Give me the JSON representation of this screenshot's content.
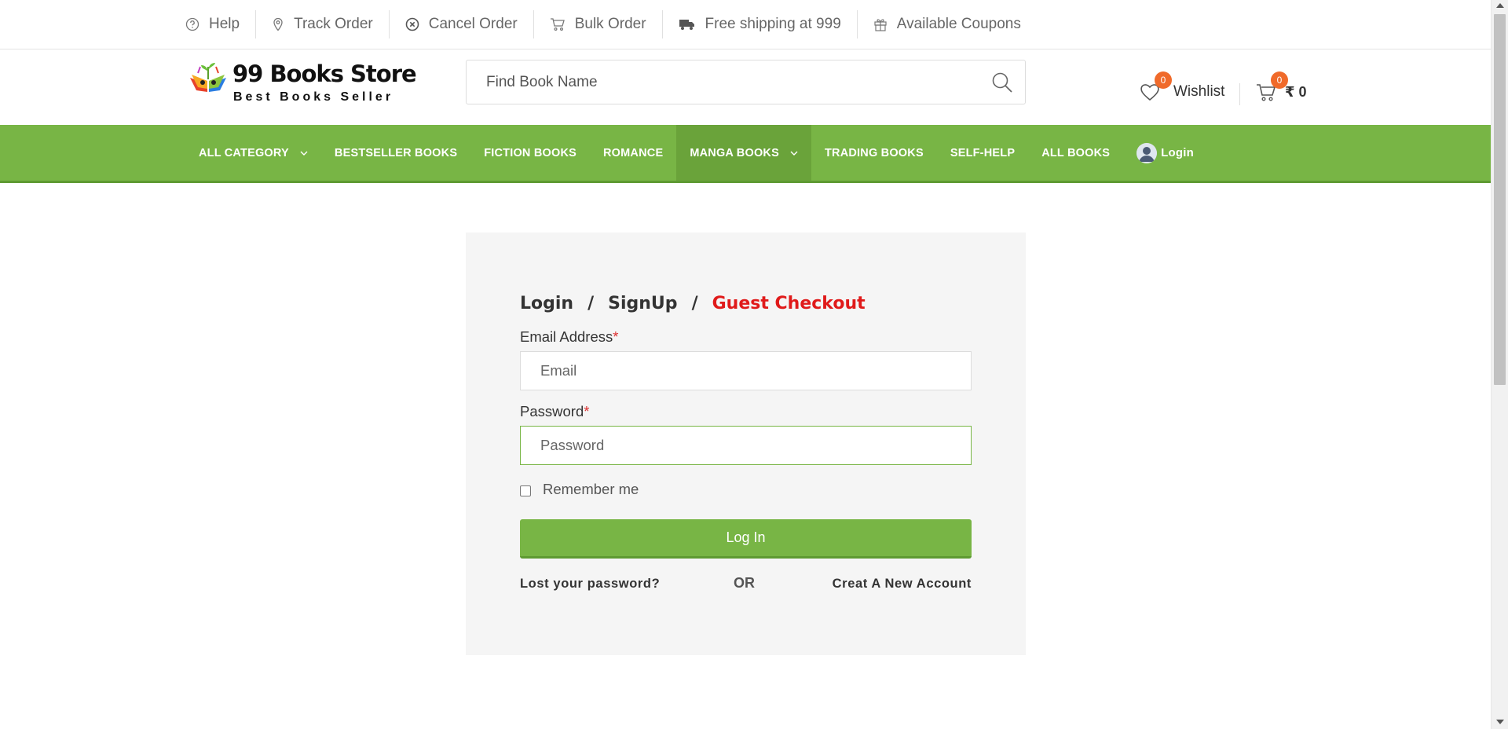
{
  "topbar": {
    "items": [
      {
        "label": "Help",
        "icon": "help-circle-icon"
      },
      {
        "label": "Track Order",
        "icon": "location-pin-icon"
      },
      {
        "label": "Cancel Order",
        "icon": "cancel-circle-icon"
      },
      {
        "label": "Bulk Order",
        "icon": "cart-icon"
      },
      {
        "label": "Free shipping at 999",
        "icon": "truck-icon"
      },
      {
        "label": "Available Coupons",
        "icon": "gift-icon"
      }
    ]
  },
  "header": {
    "logo_title": "99 Books Store",
    "logo_subtitle": "Best Books Seller",
    "search_placeholder": "Find Book Name",
    "wishlist_label": "Wishlist",
    "wishlist_count": "0",
    "cart_count": "0",
    "cart_total": "₹ 0"
  },
  "nav": {
    "items": [
      {
        "label": "ALL CATEGORY",
        "has_dropdown": true
      },
      {
        "label": "BESTSELLER BOOKS"
      },
      {
        "label": "FICTION BOOKS"
      },
      {
        "label": "ROMANCE"
      },
      {
        "label": "MANGA BOOKS",
        "has_dropdown": true,
        "active": true
      },
      {
        "label": "TRADING BOOKS"
      },
      {
        "label": "SELF-HELP"
      },
      {
        "label": "ALL BOOKS"
      }
    ],
    "login_label": "Login"
  },
  "login_form": {
    "tabs": {
      "login": "Login",
      "signup": "SignUp",
      "guest": "Guest Checkout",
      "separator": "/"
    },
    "email_label": "Email Address",
    "email_placeholder": "Email",
    "password_label": "Password",
    "password_placeholder": "Password",
    "required_mark": "*",
    "remember_label": "Remember me",
    "submit_label": "Log In",
    "lost_password": "Lost your password?",
    "or_text": "OR",
    "create_account": "Creat A New Account"
  },
  "colors": {
    "brand_green": "#78b545",
    "guest_red": "#e01a1a",
    "badge_orange": "#f06a2a"
  }
}
